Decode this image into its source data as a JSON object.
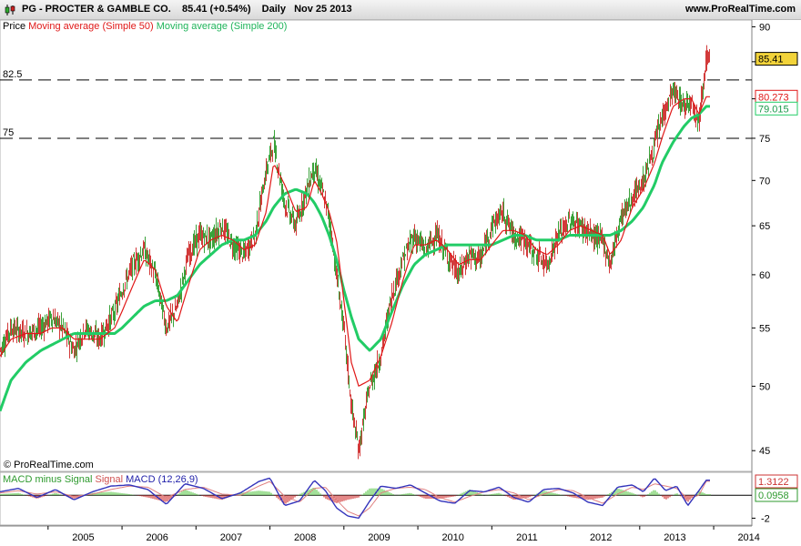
{
  "header": {
    "symbol": "PG - PROCTER & GAMBLE CO.",
    "last": "85.41 (+0.54%)",
    "period": "Daily",
    "date": "Nov 25 2013",
    "site": "www.ProRealTime.com"
  },
  "legend": {
    "price": "Price",
    "ma50": "Moving average (Simple 50)",
    "ma200": "Moving average (Simple 200)"
  },
  "macd_legend": {
    "hist": "MACD minus Signal",
    "signal": "Signal",
    "macd": "MACD (12,26,9)"
  },
  "copyright": "© ProRealTime.com",
  "colors": {
    "price_up": "#3aa23a",
    "price_down": "#d23a3a",
    "ma50": "#e01818",
    "ma200": "#22cc66",
    "macd": "#3333bb",
    "signal": "#e08080",
    "hist": "#66cc55",
    "last_badge": "#f2d33a"
  },
  "chart_data": [
    {
      "type": "line",
      "title": "PG - PROCTER & GAMBLE CO. Daily",
      "x_ticks": [
        "2005",
        "2006",
        "2007",
        "2008",
        "2009",
        "2010",
        "2011",
        "2012",
        "2013",
        "2014"
      ],
      "y_ticks": [
        "90",
        "85",
        "80",
        "75",
        "70",
        "65",
        "60",
        "55",
        "50",
        "45"
      ],
      "y_scale": "log",
      "ylim": [
        43.5,
        91
      ],
      "grid": false,
      "x_range": [
        2004.35,
        2013.95
      ],
      "hlines": [
        {
          "label": "82.5",
          "value": 82.5
        },
        {
          "label": "75",
          "value": 75
        }
      ],
      "value_labels": [
        {
          "text": "85.41",
          "value": 85.41,
          "series": "Price"
        },
        {
          "text": "80.273",
          "value": 80.273,
          "series": "Moving average (Simple 50)"
        },
        {
          "text": "79.015",
          "value": 79.015,
          "series": "Moving average (Simple 200)"
        }
      ],
      "series": [
        {
          "name": "Price",
          "x": [
            2004.35,
            2004.5,
            2004.7,
            2004.9,
            2005.05,
            2005.2,
            2005.35,
            2005.5,
            2005.7,
            2005.9,
            2006.0,
            2006.15,
            2006.3,
            2006.45,
            2006.6,
            2006.75,
            2006.9,
            2007.05,
            2007.2,
            2007.35,
            2007.5,
            2007.65,
            2007.8,
            2007.95,
            2008.05,
            2008.2,
            2008.35,
            2008.5,
            2008.6,
            2008.7,
            2008.8,
            2008.9,
            2009.0,
            2009.1,
            2009.2,
            2009.35,
            2009.5,
            2009.65,
            2009.8,
            2009.95,
            2010.1,
            2010.25,
            2010.4,
            2010.55,
            2010.7,
            2010.85,
            2011.0,
            2011.15,
            2011.3,
            2011.45,
            2011.6,
            2011.75,
            2011.9,
            2012.05,
            2012.2,
            2012.35,
            2012.5,
            2012.6,
            2012.75,
            2012.9,
            2013.05,
            2013.2,
            2013.3,
            2013.45,
            2013.6,
            2013.7,
            2013.8,
            2013.9
          ],
          "values": [
            53,
            55,
            54.5,
            55,
            56,
            55,
            53,
            55,
            54,
            56.5,
            58.5,
            61,
            62.5,
            60,
            55,
            57,
            62,
            64,
            63.5,
            65,
            63,
            62,
            64,
            71,
            74.5,
            67.5,
            65,
            69,
            71.5,
            69,
            66,
            60,
            55,
            48.5,
            45,
            50,
            52.5,
            58,
            61.5,
            64,
            62.5,
            64,
            62,
            60,
            62,
            61.5,
            65,
            66.5,
            64,
            63.5,
            62,
            61,
            64,
            65.5,
            65,
            64,
            63.5,
            61,
            66,
            68,
            70,
            74,
            77.5,
            81,
            79,
            80,
            77,
            85.41
          ]
        },
        {
          "name": "Moving average (Simple 50)",
          "x": [
            2004.35,
            2004.5,
            2004.7,
            2004.9,
            2005.05,
            2005.2,
            2005.35,
            2005.5,
            2005.7,
            2005.9,
            2006.0,
            2006.15,
            2006.3,
            2006.45,
            2006.6,
            2006.75,
            2006.9,
            2007.05,
            2007.2,
            2007.35,
            2007.5,
            2007.65,
            2007.8,
            2007.95,
            2008.05,
            2008.2,
            2008.35,
            2008.5,
            2008.6,
            2008.7,
            2008.8,
            2008.9,
            2009.0,
            2009.1,
            2009.2,
            2009.35,
            2009.5,
            2009.65,
            2009.8,
            2009.95,
            2010.1,
            2010.25,
            2010.4,
            2010.55,
            2010.7,
            2010.85,
            2011.0,
            2011.15,
            2011.3,
            2011.45,
            2011.6,
            2011.75,
            2011.9,
            2012.05,
            2012.2,
            2012.35,
            2012.5,
            2012.6,
            2012.75,
            2012.9,
            2013.05,
            2013.2,
            2013.3,
            2013.45,
            2013.6,
            2013.7,
            2013.8,
            2013.9
          ],
          "values": [
            52.5,
            54,
            54.5,
            54.5,
            55,
            55,
            54,
            54,
            54,
            55,
            56.5,
            59,
            61.5,
            60.5,
            57,
            55.5,
            59,
            62.5,
            63.5,
            64,
            63.5,
            62.5,
            63,
            66.5,
            72,
            69.5,
            66.5,
            67,
            70,
            68.5,
            66.5,
            63.5,
            57.5,
            52,
            50,
            50.5,
            52.5,
            55.5,
            59.5,
            63,
            63,
            63.5,
            62.5,
            61,
            61.5,
            61.5,
            63,
            64.5,
            64.5,
            64,
            62.5,
            62,
            63,
            64.5,
            65,
            64.5,
            64,
            62,
            63.5,
            67,
            69,
            72,
            75,
            79,
            80,
            80,
            78,
            80.273
          ]
        },
        {
          "name": "Moving average (Simple 200)",
          "x": [
            2004.35,
            2004.5,
            2004.7,
            2004.9,
            2005.05,
            2005.2,
            2005.35,
            2005.5,
            2005.7,
            2005.9,
            2006.0,
            2006.15,
            2006.3,
            2006.45,
            2006.6,
            2006.75,
            2006.9,
            2007.05,
            2007.2,
            2007.35,
            2007.5,
            2007.65,
            2007.8,
            2007.95,
            2008.05,
            2008.2,
            2008.35,
            2008.5,
            2008.6,
            2008.7,
            2008.8,
            2008.9,
            2009.0,
            2009.1,
            2009.2,
            2009.35,
            2009.5,
            2009.65,
            2009.8,
            2009.95,
            2010.1,
            2010.25,
            2010.4,
            2010.55,
            2010.7,
            2010.85,
            2011.0,
            2011.15,
            2011.3,
            2011.45,
            2011.6,
            2011.75,
            2011.9,
            2012.05,
            2012.2,
            2012.35,
            2012.5,
            2012.6,
            2012.75,
            2012.9,
            2013.05,
            2013.2,
            2013.3,
            2013.45,
            2013.6,
            2013.7,
            2013.8,
            2013.9
          ],
          "values": [
            48,
            50.5,
            52,
            53,
            53.5,
            54,
            54.5,
            54.5,
            54.5,
            54.5,
            55,
            56,
            57,
            57.5,
            57.5,
            58,
            59.5,
            61,
            62,
            63,
            63.5,
            63.5,
            64,
            65.5,
            67,
            68.5,
            69,
            68.5,
            67.5,
            66,
            64,
            61.5,
            58.5,
            56,
            54,
            53,
            54,
            56.5,
            59,
            61,
            62,
            62.5,
            63,
            63,
            63,
            63,
            63,
            63.5,
            64,
            64,
            63.5,
            63.5,
            63.5,
            64,
            64,
            64,
            64,
            64,
            64.5,
            65.5,
            67,
            69.5,
            72,
            74.5,
            76.5,
            77.5,
            78,
            79.015
          ]
        }
      ]
    },
    {
      "type": "line",
      "title": "MACD (12,26,9)",
      "y_ticks": [
        "-2"
      ],
      "grid": false,
      "value_labels": [
        {
          "text": "1.3122",
          "value": 1.3122,
          "series": "MACD (12,26,9)"
        },
        {
          "text": "0.0958",
          "value": 0.0958,
          "series": "MACD minus Signal"
        }
      ],
      "series": [
        {
          "name": "MACD (12,26,9)",
          "x": [
            2004.35,
            2004.6,
            2004.85,
            2005.1,
            2005.35,
            2005.6,
            2005.85,
            2006.1,
            2006.35,
            2006.6,
            2006.85,
            2007.1,
            2007.35,
            2007.6,
            2007.85,
            2008.0,
            2008.2,
            2008.4,
            2008.6,
            2008.75,
            2008.9,
            2009.05,
            2009.2,
            2009.35,
            2009.5,
            2009.7,
            2009.9,
            2010.1,
            2010.3,
            2010.5,
            2010.7,
            2010.9,
            2011.1,
            2011.3,
            2011.5,
            2011.7,
            2011.9,
            2012.1,
            2012.3,
            2012.5,
            2012.7,
            2012.9,
            2013.05,
            2013.2,
            2013.35,
            2013.5,
            2013.65,
            2013.8,
            2013.9
          ],
          "values": [
            0.3,
            0.6,
            -0.2,
            0.5,
            -0.4,
            0.3,
            0.8,
            0.9,
            0.5,
            -0.8,
            1.0,
            0.6,
            -0.3,
            0.2,
            1.2,
            1.5,
            -0.9,
            -0.5,
            1.3,
            0.4,
            -1.1,
            -1.8,
            -2.0,
            -0.5,
            0.8,
            0.6,
            0.9,
            0.2,
            -0.5,
            -0.7,
            0.4,
            0.3,
            0.7,
            -0.2,
            -0.6,
            0.5,
            0.6,
            0.2,
            -0.6,
            -0.9,
            0.7,
            0.9,
            0.3,
            1.5,
            0.4,
            0.8,
            -0.9,
            0.4,
            1.3122
          ]
        },
        {
          "name": "Signal",
          "x": [
            2004.35,
            2004.6,
            2004.85,
            2005.1,
            2005.35,
            2005.6,
            2005.85,
            2006.1,
            2006.35,
            2006.6,
            2006.85,
            2007.1,
            2007.35,
            2007.6,
            2007.85,
            2008.0,
            2008.2,
            2008.4,
            2008.6,
            2008.75,
            2008.9,
            2009.05,
            2009.2,
            2009.35,
            2009.5,
            2009.7,
            2009.9,
            2010.1,
            2010.3,
            2010.5,
            2010.7,
            2010.9,
            2011.1,
            2011.3,
            2011.5,
            2011.7,
            2011.9,
            2012.1,
            2012.3,
            2012.5,
            2012.7,
            2012.9,
            2013.05,
            2013.2,
            2013.35,
            2013.5,
            2013.65,
            2013.8,
            2013.9
          ],
          "values": [
            0.2,
            0.4,
            0.1,
            0.3,
            -0.1,
            0.1,
            0.5,
            0.8,
            0.7,
            -0.2,
            0.5,
            0.7,
            0.1,
            0.0,
            0.8,
            1.2,
            -0.1,
            -0.6,
            0.6,
            0.7,
            -0.4,
            -1.4,
            -1.8,
            -1.1,
            0.2,
            0.6,
            0.7,
            0.5,
            -0.2,
            -0.6,
            -0.1,
            0.3,
            0.5,
            0.2,
            -0.4,
            0.1,
            0.5,
            0.4,
            -0.2,
            -0.7,
            0.1,
            0.7,
            0.5,
            1.0,
            0.8,
            0.6,
            -0.3,
            0.0,
            1.2164
          ]
        },
        {
          "name": "MACD minus Signal",
          "x": [
            2004.35,
            2004.6,
            2004.85,
            2005.1,
            2005.35,
            2005.6,
            2005.85,
            2006.1,
            2006.35,
            2006.6,
            2006.85,
            2007.1,
            2007.35,
            2007.6,
            2007.85,
            2008.0,
            2008.2,
            2008.4,
            2008.6,
            2008.75,
            2008.9,
            2009.05,
            2009.2,
            2009.35,
            2009.5,
            2009.7,
            2009.9,
            2010.1,
            2010.3,
            2010.5,
            2010.7,
            2010.9,
            2011.1,
            2011.3,
            2011.5,
            2011.7,
            2011.9,
            2012.1,
            2012.3,
            2012.5,
            2012.7,
            2012.9,
            2013.05,
            2013.2,
            2013.35,
            2013.5,
            2013.65,
            2013.8,
            2013.9
          ],
          "values": [
            0.1,
            0.2,
            -0.3,
            0.2,
            -0.3,
            0.2,
            0.3,
            0.1,
            -0.2,
            -0.6,
            0.5,
            -0.1,
            -0.4,
            0.2,
            0.4,
            0.3,
            -0.8,
            0.1,
            0.7,
            -0.3,
            -0.7,
            -0.4,
            -0.2,
            0.6,
            0.6,
            0.0,
            0.2,
            -0.3,
            -0.3,
            -0.1,
            0.5,
            0.0,
            0.2,
            -0.4,
            -0.2,
            0.4,
            0.1,
            -0.2,
            -0.4,
            -0.2,
            0.6,
            0.2,
            -0.2,
            0.5,
            -0.4,
            0.2,
            -0.6,
            0.4,
            0.0958
          ]
        }
      ]
    }
  ]
}
